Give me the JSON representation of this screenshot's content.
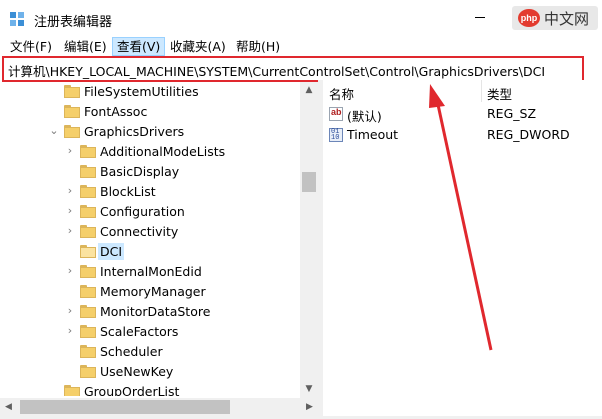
{
  "window": {
    "title": "注册表编辑器"
  },
  "watermark": {
    "badge": "php",
    "text": "中文网"
  },
  "menu": {
    "items": [
      {
        "label": "文件(F)"
      },
      {
        "label": "编辑(E)"
      },
      {
        "label": "查看(V)"
      },
      {
        "label": "收藏夹(A)"
      },
      {
        "label": "帮助(H)"
      }
    ]
  },
  "address": {
    "path": "计算机\\HKEY_LOCAL_MACHINE\\SYSTEM\\CurrentControlSet\\Control\\GraphicsDrivers\\DCI"
  },
  "tree": {
    "items": [
      {
        "label": "FileSystemUtilities",
        "depth": 0,
        "expander": "none",
        "selected": false
      },
      {
        "label": "FontAssoc",
        "depth": 0,
        "expander": "none",
        "selected": false
      },
      {
        "label": "GraphicsDrivers",
        "depth": 0,
        "expander": "expanded",
        "selected": false
      },
      {
        "label": "AdditionalModeLists",
        "depth": 1,
        "expander": "collapsed",
        "selected": false
      },
      {
        "label": "BasicDisplay",
        "depth": 1,
        "expander": "none",
        "selected": false
      },
      {
        "label": "BlockList",
        "depth": 1,
        "expander": "collapsed",
        "selected": false
      },
      {
        "label": "Configuration",
        "depth": 1,
        "expander": "collapsed",
        "selected": false
      },
      {
        "label": "Connectivity",
        "depth": 1,
        "expander": "collapsed",
        "selected": false
      },
      {
        "label": "DCI",
        "depth": 1,
        "expander": "none",
        "selected": true
      },
      {
        "label": "InternalMonEdid",
        "depth": 1,
        "expander": "collapsed",
        "selected": false
      },
      {
        "label": "MemoryManager",
        "depth": 1,
        "expander": "none",
        "selected": false
      },
      {
        "label": "MonitorDataStore",
        "depth": 1,
        "expander": "collapsed",
        "selected": false
      },
      {
        "label": "ScaleFactors",
        "depth": 1,
        "expander": "collapsed",
        "selected": false
      },
      {
        "label": "Scheduler",
        "depth": 1,
        "expander": "none",
        "selected": false
      },
      {
        "label": "UseNewKey",
        "depth": 1,
        "expander": "none",
        "selected": false
      },
      {
        "label": "GroupOrderList",
        "depth": 0,
        "expander": "none",
        "selected": false
      }
    ]
  },
  "list": {
    "headers": {
      "name": "名称",
      "type": "类型"
    },
    "rows": [
      {
        "name": "(默认)",
        "type": "REG_SZ",
        "icon": "string-value-icon"
      },
      {
        "name": "Timeout",
        "type": "REG_DWORD",
        "icon": "dword-value-icon"
      }
    ]
  },
  "colors": {
    "annotation": "#e0282e",
    "selection": "#cce8ff",
    "folder": "#f5cf6a"
  }
}
